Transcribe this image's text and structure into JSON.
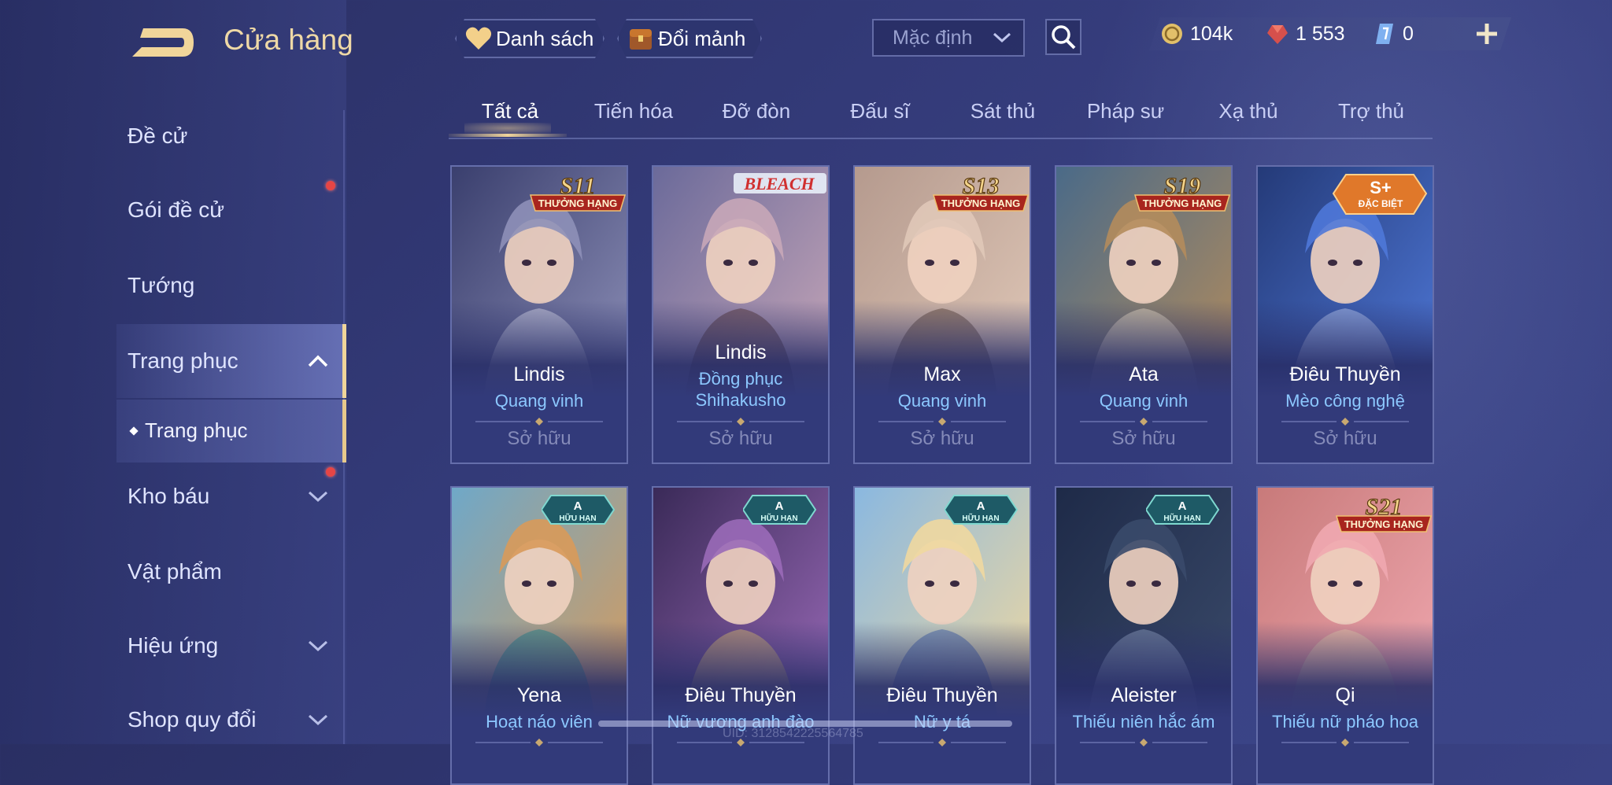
{
  "header": {
    "title": "Cửa hàng",
    "wishlist_label": "Danh sách",
    "exchange_label": "Đổi mảnh",
    "sort_value": "Mặc định",
    "currencies": [
      {
        "icon": "gold-coin-icon",
        "value": "104k"
      },
      {
        "icon": "ruby-gem-icon",
        "value": "1 553"
      },
      {
        "icon": "voucher-icon",
        "value": "0"
      }
    ]
  },
  "sidebar": {
    "items": [
      {
        "label": "Đề cử"
      },
      {
        "label": "Gói đề cử"
      },
      {
        "label": "Tướng"
      },
      {
        "label": "Trang phục"
      },
      {
        "label": "Kho báu"
      },
      {
        "label": "Vật phẩm"
      },
      {
        "label": "Hiệu ứng"
      },
      {
        "label": "Shop quy đổi"
      }
    ],
    "subitem": "Trang phục"
  },
  "tabs": [
    "Tất cả",
    "Tiến hóa",
    "Đỡ đòn",
    "Đấu sĩ",
    "Sát thủ",
    "Pháp sư",
    "Xạ thủ",
    "Trợ thủ"
  ],
  "cards": [
    {
      "name": "Lindis",
      "sub": "Quang vinh",
      "status": "Sở hữu",
      "badge_top": "S11",
      "badge_bottom": "THƯỞNG HẠNG",
      "colors": [
        "#3a3f6e",
        "#8e90b8",
        "#d8d8e8"
      ]
    },
    {
      "name": "Lindis",
      "sub": "Đồng phục Shihakusho",
      "status": "Sở hữu",
      "badge_top": "BLEACH",
      "badge_bottom": "",
      "colors": [
        "#6b6a9a",
        "#c8a7b8",
        "#5a3a3a"
      ]
    },
    {
      "name": "Max",
      "sub": "Quang vinh",
      "status": "Sở hữu",
      "badge_top": "S13",
      "badge_bottom": "THƯỞNG HẠNG",
      "colors": [
        "#b59a8e",
        "#e0c8b8",
        "#6a5040"
      ]
    },
    {
      "name": "Ata",
      "sub": "Quang vinh",
      "status": "Sở hữu",
      "badge_top": "S19",
      "badge_bottom": "THƯỞNG HẠNG",
      "colors": [
        "#4a6a88",
        "#b48c5c",
        "#e8d8c0"
      ]
    },
    {
      "name": "Điêu Thuyền",
      "sub": "Mèo công nghệ",
      "status": "Sở hữu",
      "badge_top": "S+",
      "badge_bottom": "ĐẶC BIỆT",
      "colors": [
        "#243a78",
        "#4f78d8",
        "#b8c8f0"
      ]
    },
    {
      "name": "Yena",
      "sub": "Hoạt náo viên",
      "status": "",
      "badge_top": "A",
      "badge_bottom": "HỮU HẠN",
      "colors": [
        "#6fa8c8",
        "#d89a5a",
        "#2e8a88"
      ]
    },
    {
      "name": "Điêu Thuyền",
      "sub": "Nữ vương anh đào",
      "status": "",
      "badge_top": "A",
      "badge_bottom": "HỮU HẠN",
      "colors": [
        "#3a2a58",
        "#9a6ab8",
        "#d8b870"
      ]
    },
    {
      "name": "Điêu Thuyền",
      "sub": "Nữ y tá",
      "status": "",
      "badge_top": "A",
      "badge_bottom": "HỮU HẠN",
      "colors": [
        "#8ab8e0",
        "#f0d8a0",
        "#4a6aa8"
      ]
    },
    {
      "name": "Aleister",
      "sub": "Thiếu niên hắc ám",
      "status": "",
      "badge_top": "A",
      "badge_bottom": "HỮU HẠN",
      "colors": [
        "#1e2a48",
        "#3a4a6a",
        "#8a9ab8"
      ]
    },
    {
      "name": "Qi",
      "sub": "Thiếu nữ pháo hoa",
      "status": "",
      "badge_top": "S21",
      "badge_bottom": "THƯỞNG HẠNG",
      "colors": [
        "#c87a7a",
        "#f0a8b0",
        "#e8c8a8"
      ]
    }
  ],
  "uid_text": "UID: 3128542225564785",
  "accent": "#f0d59a"
}
